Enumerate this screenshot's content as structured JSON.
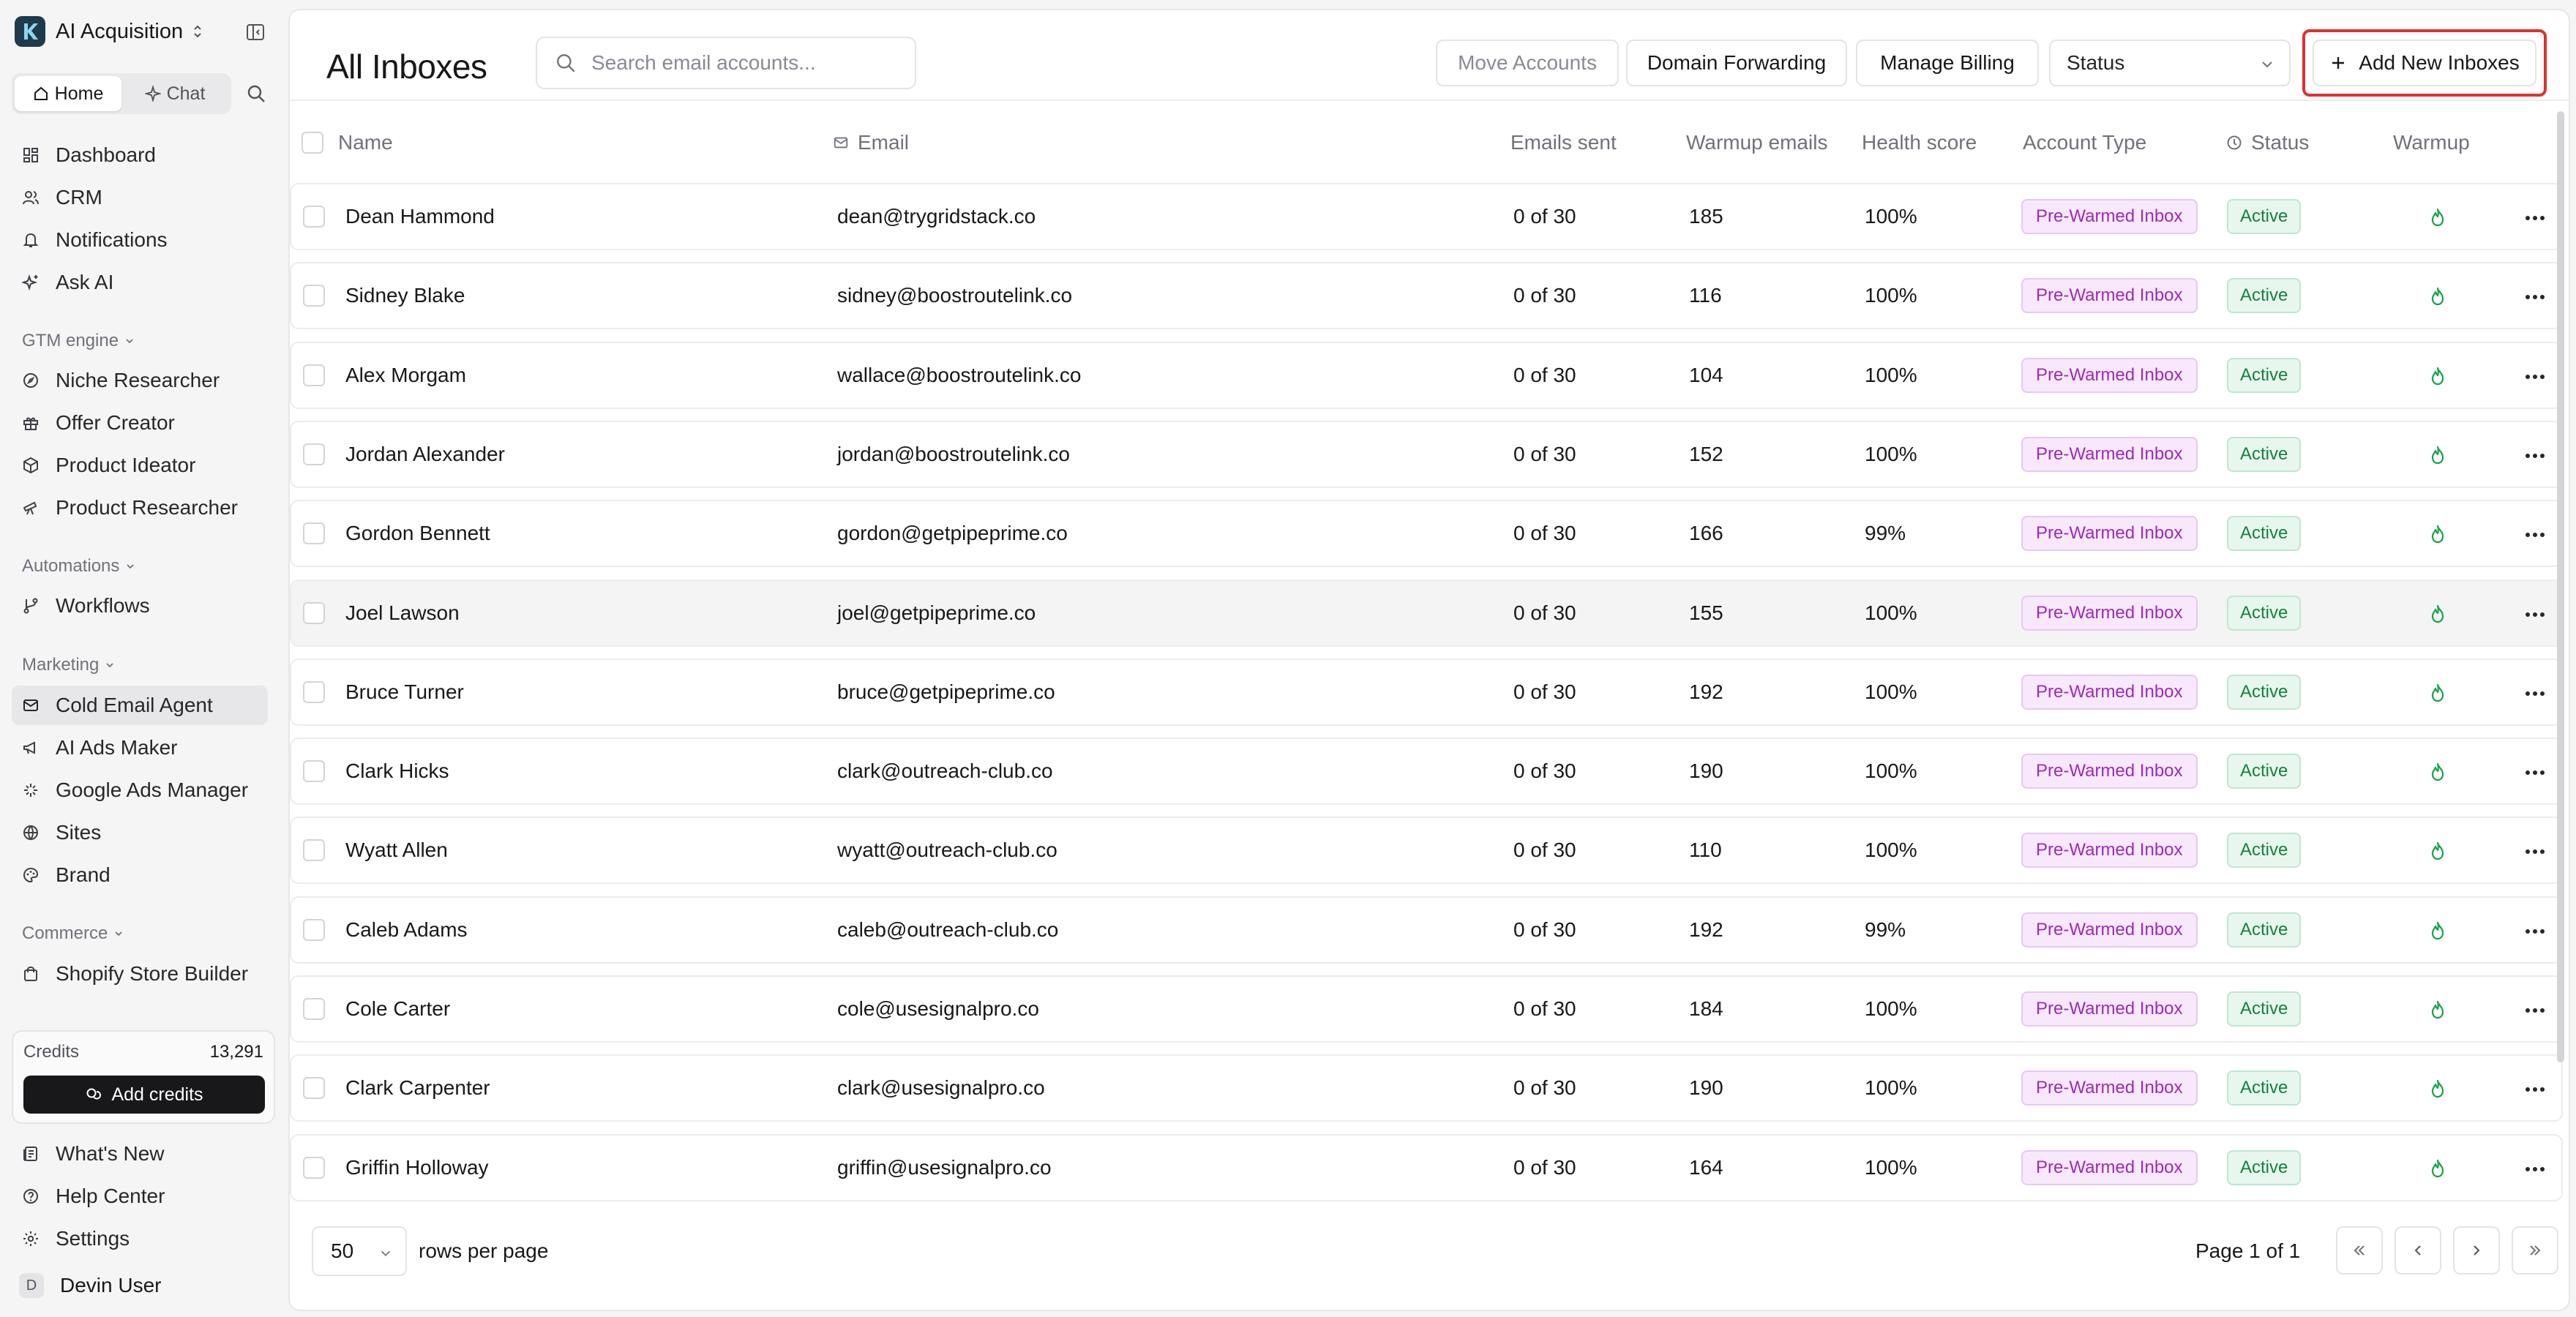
{
  "workspace": {
    "name": "AI Acquisition"
  },
  "sidebar": {
    "mode_tabs": [
      {
        "label": "Home"
      },
      {
        "label": "Chat"
      }
    ],
    "primary": [
      {
        "label": "Dashboard"
      },
      {
        "label": "CRM"
      },
      {
        "label": "Notifications"
      },
      {
        "label": "Ask AI"
      }
    ],
    "gtm": {
      "title": "GTM engine",
      "items": [
        {
          "label": "Niche Researcher"
        },
        {
          "label": "Offer Creator"
        },
        {
          "label": "Product Ideator"
        },
        {
          "label": "Product Researcher"
        }
      ]
    },
    "automations": {
      "title": "Automations",
      "items": [
        {
          "label": "Workflows"
        }
      ]
    },
    "marketing": {
      "title": "Marketing",
      "items": [
        {
          "label": "Cold Email Agent"
        },
        {
          "label": "AI Ads Maker"
        },
        {
          "label": "Google Ads Manager"
        },
        {
          "label": "Sites"
        },
        {
          "label": "Brand"
        }
      ]
    },
    "commerce": {
      "title": "Commerce",
      "items": [
        {
          "label": "Shopify Store Builder"
        }
      ]
    },
    "credits": {
      "label": "Credits",
      "value": "13,291",
      "button": "Add credits"
    },
    "bottom": [
      {
        "label": "What's New"
      },
      {
        "label": "Help Center"
      },
      {
        "label": "Settings"
      }
    ],
    "user": {
      "initial": "D",
      "name": "Devin User"
    }
  },
  "header": {
    "title": "All Inboxes",
    "search_placeholder": "Search email accounts...",
    "move_accounts": "Move Accounts",
    "domain_forwarding": "Domain Forwarding",
    "manage_billing": "Manage Billing",
    "status_select": "Status",
    "add_new": "Add New Inboxes"
  },
  "table": {
    "columns": {
      "name": "Name",
      "email": "Email",
      "sent": "Emails sent",
      "warmup_emails": "Warmup emails",
      "health": "Health score",
      "type": "Account Type",
      "status": "Status",
      "warmup": "Warmup"
    },
    "rows": [
      {
        "name": "Dean Hammond",
        "email": "dean@trygridstack.co",
        "sent": "0 of 30",
        "warmup": "185",
        "health": "100%",
        "type": "Pre-Warmed Inbox",
        "status": "Active"
      },
      {
        "name": "Sidney Blake",
        "email": "sidney@boostroutelink.co",
        "sent": "0 of 30",
        "warmup": "116",
        "health": "100%",
        "type": "Pre-Warmed Inbox",
        "status": "Active"
      },
      {
        "name": "Alex Morgam",
        "email": "wallace@boostroutelink.co",
        "sent": "0 of 30",
        "warmup": "104",
        "health": "100%",
        "type": "Pre-Warmed Inbox",
        "status": "Active"
      },
      {
        "name": "Jordan Alexander",
        "email": "jordan@boostroutelink.co",
        "sent": "0 of 30",
        "warmup": "152",
        "health": "100%",
        "type": "Pre-Warmed Inbox",
        "status": "Active"
      },
      {
        "name": "Gordon Bennett",
        "email": "gordon@getpipeprime.co",
        "sent": "0 of 30",
        "warmup": "166",
        "health": "99%",
        "type": "Pre-Warmed Inbox",
        "status": "Active"
      },
      {
        "name": "Joel Lawson",
        "email": "joel@getpipeprime.co",
        "sent": "0 of 30",
        "warmup": "155",
        "health": "100%",
        "type": "Pre-Warmed Inbox",
        "status": "Active"
      },
      {
        "name": "Bruce Turner",
        "email": "bruce@getpipeprime.co",
        "sent": "0 of 30",
        "warmup": "192",
        "health": "100%",
        "type": "Pre-Warmed Inbox",
        "status": "Active"
      },
      {
        "name": "Clark Hicks",
        "email": "clark@outreach-club.co",
        "sent": "0 of 30",
        "warmup": "190",
        "health": "100%",
        "type": "Pre-Warmed Inbox",
        "status": "Active"
      },
      {
        "name": "Wyatt Allen",
        "email": "wyatt@outreach-club.co",
        "sent": "0 of 30",
        "warmup": "110",
        "health": "100%",
        "type": "Pre-Warmed Inbox",
        "status": "Active"
      },
      {
        "name": "Caleb Adams",
        "email": "caleb@outreach-club.co",
        "sent": "0 of 30",
        "warmup": "192",
        "health": "99%",
        "type": "Pre-Warmed Inbox",
        "status": "Active"
      },
      {
        "name": "Cole Carter",
        "email": "cole@usesignalpro.co",
        "sent": "0 of 30",
        "warmup": "184",
        "health": "100%",
        "type": "Pre-Warmed Inbox",
        "status": "Active"
      },
      {
        "name": "Clark Carpenter",
        "email": "clark@usesignalpro.co",
        "sent": "0 of 30",
        "warmup": "190",
        "health": "100%",
        "type": "Pre-Warmed Inbox",
        "status": "Active"
      },
      {
        "name": "Griffin Holloway",
        "email": "griffin@usesignalpro.co",
        "sent": "0 of 30",
        "warmup": "164",
        "health": "100%",
        "type": "Pre-Warmed Inbox",
        "status": "Active"
      }
    ]
  },
  "footer": {
    "per_page": "50",
    "per_page_label": "rows per page",
    "page_info": "Page 1 of 1"
  },
  "colors": {
    "accent_highlight": "#e03131",
    "badge_type": "#9c2bb5",
    "badge_active": "#15803d",
    "flame": "#16a34a"
  },
  "icons": {
    "row_warmup": "flame-icon",
    "row_menu": "more-horizontal-icon",
    "add": "plus-icon",
    "search": "search-icon"
  }
}
